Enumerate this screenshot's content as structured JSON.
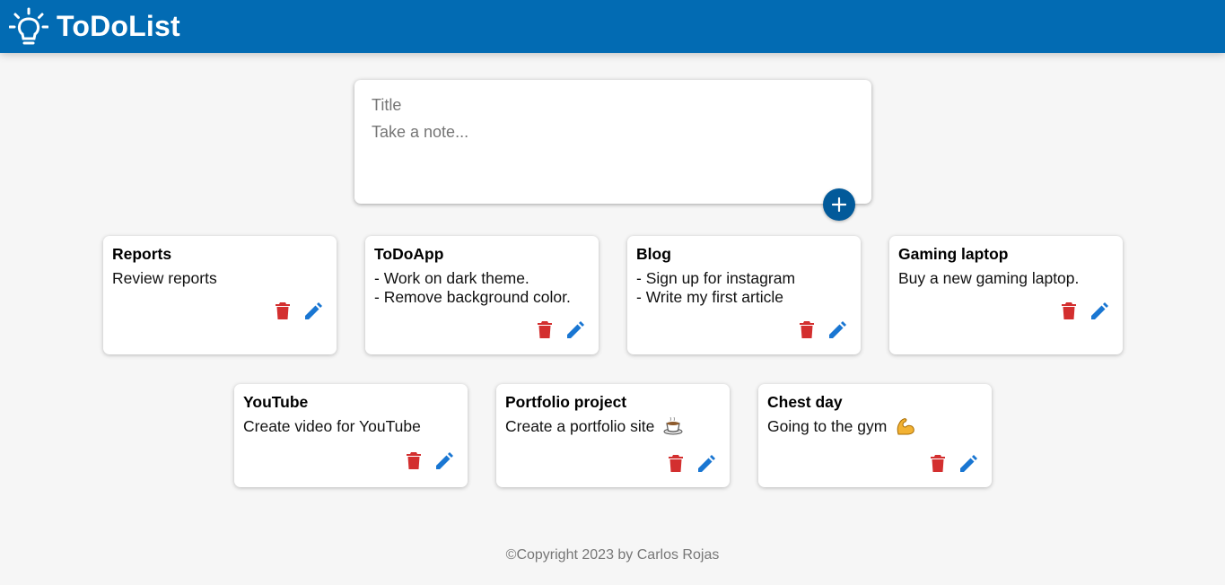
{
  "header": {
    "title": "ToDoList",
    "logo_icon": "lightbulb-icon"
  },
  "create": {
    "title_placeholder": "Title",
    "content_placeholder": "Take a note...",
    "add_icon": "plus-icon"
  },
  "notes": [
    {
      "title": "Reports",
      "lines": [
        "Review reports"
      ]
    },
    {
      "title": "ToDoApp",
      "lines": [
        "- Work on dark theme.",
        "- Remove background color."
      ]
    },
    {
      "title": "Blog",
      "lines": [
        "- Sign up for instagram",
        "- Write my first article"
      ]
    },
    {
      "title": "Gaming laptop",
      "lines": [
        "Buy a new gaming laptop."
      ]
    },
    {
      "title": "YouTube",
      "lines": [
        "Create video for YouTube"
      ]
    },
    {
      "title": "Portfolio project",
      "lines": [
        "Create a portfolio site"
      ],
      "emoji": "coffee-icon"
    },
    {
      "title": "Chest day",
      "lines": [
        "Going to the gym"
      ],
      "emoji": "flexed-biceps-icon"
    }
  ],
  "icons": {
    "delete": "trash-icon",
    "edit": "pencil-icon"
  },
  "colors": {
    "header": "#026bb3",
    "add_button": "#025a9a",
    "delete": "#d32f2f",
    "edit": "#1976d2"
  },
  "footer": {
    "text": "©Copyright 2023 by Carlos Rojas"
  }
}
